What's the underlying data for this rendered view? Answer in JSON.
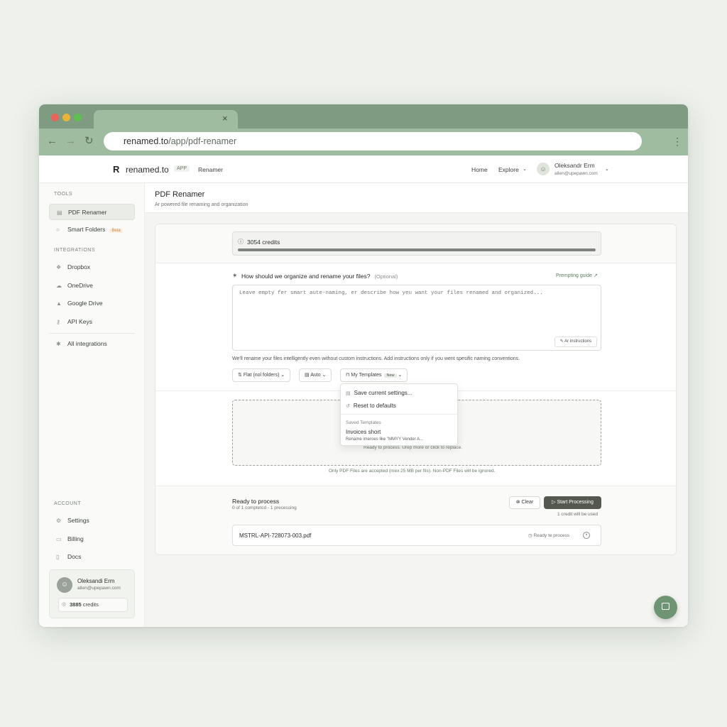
{
  "browser": {
    "url_host": "renamed.to",
    "url_path": "/app/pdf-renamer",
    "tab_close": "×",
    "back": "←",
    "forward": "→",
    "reload": "↻",
    "menu": "⋮",
    "colors": {
      "frame": "#7f9c82",
      "toolbar": "#9fbba0"
    }
  },
  "header": {
    "logo_mark": "R",
    "logo_text": "renamed.to",
    "app_badge": "APP",
    "crumb": "Renamer",
    "nav": {
      "home": "Home",
      "explore": "Explore"
    },
    "user": {
      "name": "Oleksandr Erm",
      "email": "allen@upepawn.com"
    }
  },
  "sidebar": {
    "tools_heading": "TOOLS",
    "tools": [
      {
        "label": "PDF Renamer",
        "active": true
      },
      {
        "label": "Smart Folders",
        "badge": "Beta"
      }
    ],
    "integrations_heading": "INTEGRATIONS",
    "integrations": [
      {
        "label": "Dropbox"
      },
      {
        "label": "OneDrive"
      },
      {
        "label": "Google Drive"
      },
      {
        "label": "API Keys"
      }
    ],
    "all_integrations": "All integrations",
    "account_heading": "ACCOUNT",
    "account": [
      {
        "label": "Settings"
      },
      {
        "label": "Billing"
      },
      {
        "label": "Docs"
      }
    ],
    "user_card": {
      "name": "Oleksandi Erm",
      "email": "allen@upepawn.com",
      "credits_value": "3885",
      "credits_label": "credits"
    },
    "avatar_letter": "N"
  },
  "page": {
    "title": "PDF Renamer",
    "subtitle": "Ar powered file renaming and organization"
  },
  "credits": {
    "value": "3054",
    "label": "credits"
  },
  "prompt": {
    "question": "How should we organize and rename your files?",
    "optional": "(Optional)",
    "guide_link": "Prempting guide",
    "placeholder": "Leave empty fer smart aute-naming, er describe how yeu want your files renamed and organized...",
    "ai_button": "Ar instructions",
    "hint": "We'll rename your files intelligently even without custom instructions. Add instructions only if you went spesific naming conventions."
  },
  "options": {
    "folders": "Flat (nol folders)",
    "mode": "Auto",
    "templates": "My Templates",
    "templates_badge": "New"
  },
  "templates_menu": {
    "save": "Save current settings...",
    "reset": "Reset to defaults",
    "saved_heading": "Saved Templates",
    "template_name": "Invoices short",
    "template_desc": "Rename imeroes like \"MMYY Vender A..."
  },
  "dropzone": {
    "text": "Ready to process. Urep more or click to replace.",
    "note": "Only PDF Files are accepted (mex 25 MB per fils). Non-PDF Files will be ignored."
  },
  "process": {
    "title": "Ready to process",
    "subtitle": "0 of 1 comptetcd - 1 precessing",
    "clear": "Clear",
    "start": "Start Processing",
    "credit_note": "1 credit will be used"
  },
  "file": {
    "name": "MSTRL-API-728073-003.pdf",
    "status": "Ready te process"
  }
}
